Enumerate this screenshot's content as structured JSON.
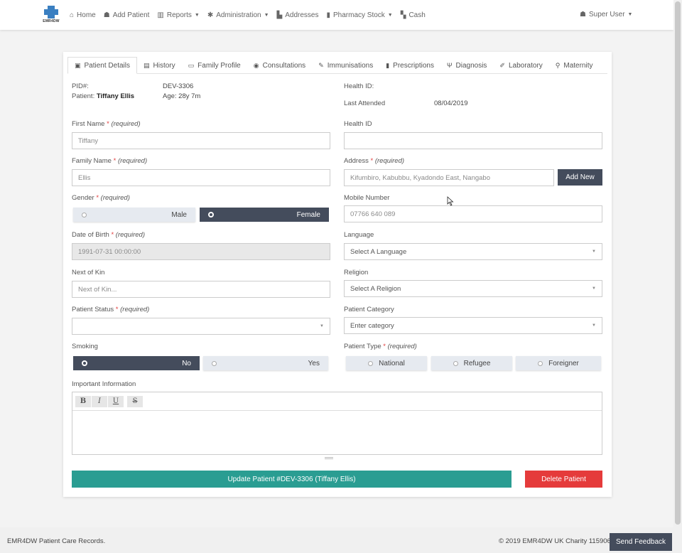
{
  "nav": {
    "logo_text": "EMR4DW",
    "items": [
      {
        "label": "Home",
        "icon": "home-icon",
        "glyph": "⌂",
        "dropdown": false
      },
      {
        "label": "Add Patient",
        "icon": "add-user-icon",
        "glyph": "☗",
        "dropdown": false
      },
      {
        "label": "Reports",
        "icon": "chart-icon",
        "glyph": "▥",
        "dropdown": true
      },
      {
        "label": "Administration",
        "icon": "gear-icon",
        "glyph": "✱",
        "dropdown": true
      },
      {
        "label": "Addresses",
        "icon": "map-icon",
        "glyph": "▙",
        "dropdown": false
      },
      {
        "label": "Pharmacy Stock",
        "icon": "pill-icon",
        "glyph": "▮",
        "dropdown": true
      },
      {
        "label": "Cash",
        "icon": "cash-icon",
        "glyph": "▚",
        "dropdown": false
      }
    ],
    "user": "Super User"
  },
  "tabs": [
    {
      "label": "Patient Details",
      "glyph": "▣",
      "active": true
    },
    {
      "label": "History",
      "glyph": "▤",
      "active": false
    },
    {
      "label": "Family Profile",
      "glyph": "▭",
      "active": false
    },
    {
      "label": "Consultations",
      "glyph": "◉",
      "active": false
    },
    {
      "label": "Immunisations",
      "glyph": "✎",
      "active": false
    },
    {
      "label": "Prescriptions",
      "glyph": "▮",
      "active": false
    },
    {
      "label": "Diagnosis",
      "glyph": "Ψ",
      "active": false
    },
    {
      "label": "Laboratory",
      "glyph": "✐",
      "active": false
    },
    {
      "label": "Maternity",
      "glyph": "⚲",
      "active": false
    }
  ],
  "summary": {
    "pid_label": "PID#:",
    "pid_value": "DEV-3306",
    "patient_label": "Patient:",
    "patient_name": "Tiffany Ellis",
    "age": "Age: 28y 7m",
    "health_id_label": "Health ID:",
    "last_attended_label": "Last Attended",
    "last_attended_value": "08/04/2019"
  },
  "form": {
    "required_text": "(required)",
    "first_name": {
      "label": "First Name",
      "value": "Tiffany"
    },
    "health_id": {
      "label": "Health ID",
      "value": ""
    },
    "family_name": {
      "label": "Family Name",
      "value": "Ellis"
    },
    "address": {
      "label": "Address",
      "value": "Kifumbiro, Kabubbu, Kyadondo East, Nangabo",
      "button": "Add New"
    },
    "gender": {
      "label": "Gender",
      "options": [
        "Male",
        "Female"
      ],
      "selected": "Female"
    },
    "mobile": {
      "label": "Mobile Number",
      "value": "07766 640 089"
    },
    "dob": {
      "label": "Date of Birth",
      "value": "1991-07-31 00:00:00"
    },
    "language": {
      "label": "Language",
      "placeholder": "Select A Language"
    },
    "next_of_kin": {
      "label": "Next of Kin",
      "placeholder": "Next of Kin..."
    },
    "religion": {
      "label": "Religion",
      "placeholder": "Select A Religion"
    },
    "patient_status": {
      "label": "Patient Status",
      "value": ""
    },
    "patient_category": {
      "label": "Patient Category",
      "placeholder": "Enter category"
    },
    "smoking": {
      "label": "Smoking",
      "options": [
        "No",
        "Yes"
      ],
      "selected": "No"
    },
    "patient_type": {
      "label": "Patient Type",
      "options": [
        "National",
        "Refugee",
        "Foreigner"
      ],
      "selected": ""
    },
    "important_info": {
      "label": "Important Information",
      "toolbar": [
        "B",
        "I",
        "U",
        "S"
      ]
    }
  },
  "actions": {
    "update": "Update Patient #DEV-3306 (Tiffany Ellis)",
    "delete": "Delete Patient"
  },
  "footer": {
    "left": "EMR4DW Patient Care Records.",
    "right": "© 2019 EMR4DW  UK Charity 1159060",
    "feedback": "Send Feedback"
  },
  "colors": {
    "accent_dark": "#444c5c",
    "teal": "#2a9d92",
    "danger": "#e53b3b",
    "brand_blue": "#3a7fc1"
  }
}
